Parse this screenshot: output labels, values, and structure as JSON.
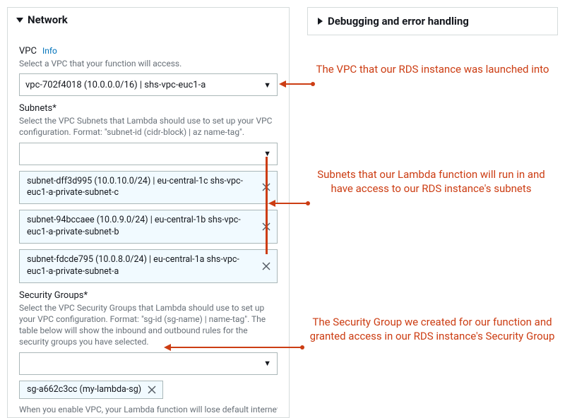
{
  "panels": {
    "network_title": "Network",
    "debug_title": "Debugging and error handling"
  },
  "vpc": {
    "label": "VPC",
    "info_link": "Info",
    "help": "Select a VPC that your function will access.",
    "selected": "vpc-702f4018 (10.0.0.0/16) | shs-vpc-euc1-a"
  },
  "subnets": {
    "label": "Subnets*",
    "help": "Select the VPC Subnets that Lambda should use to set up your VPC configuration. Format: \"subnet-id (cidr-block) | az name-tag\".",
    "placeholder": "",
    "items": [
      "subnet-dff3d995 (10.0.10.0/24) | eu-central-1c shs-vpc-euc1-a-private-subnet-c",
      "subnet-94bccaee (10.0.9.0/24) | eu-central-1b shs-vpc-euc1-a-private-subnet-b",
      "subnet-fdcde795 (10.0.8.0/24) | eu-central-1a shs-vpc-euc1-a-private-subnet-a"
    ]
  },
  "security_groups": {
    "label": "Security Groups*",
    "help": "Select the VPC Security Groups that Lambda should use to set up your VPC configuration. Format: \"sg-id (sg-name) | name-tag\". The table below will show the inbound and outbound rules for the security groups you have selected.",
    "placeholder": "",
    "items": [
      "sg-a662c3cc (my-lambda-sg)"
    ]
  },
  "truncated": "When you enable VPC, your Lambda function will lose default internet",
  "annotations": {
    "vpc": "The VPC that our RDS instance was launched into",
    "subnets": "Subnets that our Lambda function will run in and have access to our RDS instance's subnets",
    "sg": "The Security Group we created for our function and granted access in our RDS instance's Security Group"
  },
  "colors": {
    "accent": "#cc3d13",
    "link": "#0073bb"
  }
}
